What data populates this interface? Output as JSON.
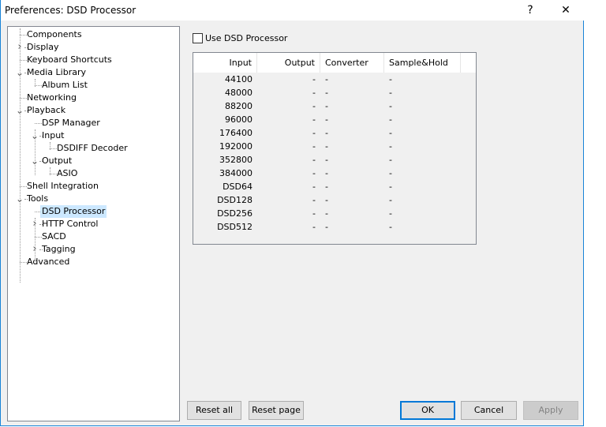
{
  "window": {
    "title": "Preferences: DSD Processor",
    "help": "?",
    "close": "✕"
  },
  "tree": [
    {
      "label": "Components",
      "level": 0,
      "exp": ""
    },
    {
      "label": "Display",
      "level": 0,
      "exp": "collapsed"
    },
    {
      "label": "Keyboard Shortcuts",
      "level": 0,
      "exp": ""
    },
    {
      "label": "Media Library",
      "level": 0,
      "exp": "expanded"
    },
    {
      "label": "Album List",
      "level": 1,
      "exp": ""
    },
    {
      "label": "Networking",
      "level": 0,
      "exp": ""
    },
    {
      "label": "Playback",
      "level": 0,
      "exp": "expanded"
    },
    {
      "label": "DSP Manager",
      "level": 1,
      "exp": ""
    },
    {
      "label": "Input",
      "level": 1,
      "exp": "expanded"
    },
    {
      "label": "DSDIFF Decoder",
      "level": 2,
      "exp": ""
    },
    {
      "label": "Output",
      "level": 1,
      "exp": "expanded"
    },
    {
      "label": "ASIO",
      "level": 2,
      "exp": ""
    },
    {
      "label": "Shell Integration",
      "level": 0,
      "exp": ""
    },
    {
      "label": "Tools",
      "level": 0,
      "exp": "expanded"
    },
    {
      "label": "DSD Processor",
      "level": 1,
      "exp": "",
      "selected": true
    },
    {
      "label": "HTTP Control",
      "level": 1,
      "exp": "collapsed"
    },
    {
      "label": "SACD",
      "level": 1,
      "exp": ""
    },
    {
      "label": "Tagging",
      "level": 1,
      "exp": "collapsed"
    },
    {
      "label": "Advanced",
      "level": 0,
      "exp": ""
    }
  ],
  "use_dsd": {
    "label": "Use DSD Processor",
    "checked": false
  },
  "table": {
    "headers": [
      "Input",
      "Output",
      "Converter",
      "Sample&Hold"
    ],
    "rows": [
      [
        "44100",
        "-",
        "-",
        "-"
      ],
      [
        "48000",
        "-",
        "-",
        "-"
      ],
      [
        "88200",
        "-",
        "-",
        "-"
      ],
      [
        "96000",
        "-",
        "-",
        "-"
      ],
      [
        "176400",
        "-",
        "-",
        "-"
      ],
      [
        "192000",
        "-",
        "-",
        "-"
      ],
      [
        "352800",
        "-",
        "-",
        "-"
      ],
      [
        "384000",
        "-",
        "-",
        "-"
      ],
      [
        "DSD64",
        "-",
        "-",
        "-"
      ],
      [
        "DSD128",
        "-",
        "-",
        "-"
      ],
      [
        "DSD256",
        "-",
        "-",
        "-"
      ],
      [
        "DSD512",
        "-",
        "-",
        "-"
      ]
    ]
  },
  "buttons": {
    "reset_all": "Reset all",
    "reset_page": "Reset page",
    "ok": "OK",
    "cancel": "Cancel",
    "apply": "Apply"
  },
  "colors": {
    "accent": "#0078d7",
    "selection": "#cce8ff"
  }
}
